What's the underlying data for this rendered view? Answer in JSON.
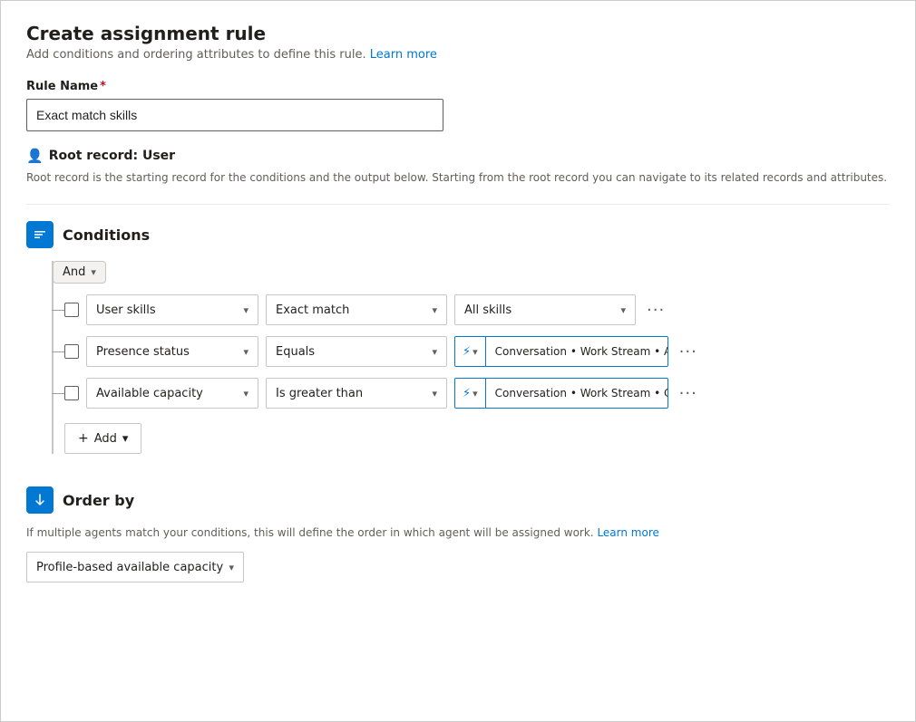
{
  "page": {
    "title": "Create assignment rule",
    "subtitle": "Add conditions and ordering attributes to define this rule.",
    "learn_more_link": "Learn more"
  },
  "rule_name": {
    "label": "Rule Name",
    "required": true,
    "value": "Exact match skills",
    "placeholder": "Rule Name"
  },
  "root_record": {
    "icon": "👤",
    "label": "Root record: User",
    "description": "Root record is the starting record for the conditions and the output below. Starting from the root record you can navigate to its related records and attributes."
  },
  "conditions": {
    "section_title": "Conditions",
    "and_label": "And",
    "rows": [
      {
        "field": "User skills",
        "operator": "Exact match",
        "value_text": "All skills",
        "value_type": "static",
        "has_dynamic": false
      },
      {
        "field": "Presence status",
        "operator": "Equals",
        "value_text": "Conversation • Work Stream • All...",
        "value_type": "dynamic",
        "has_dynamic": true
      },
      {
        "field": "Available capacity",
        "operator": "Is greater than",
        "value_text": "Conversation • Work Stream • Ca...",
        "value_type": "dynamic",
        "has_dynamic": true
      }
    ],
    "add_label": "Add"
  },
  "order_by": {
    "section_title": "Order by",
    "description": "If multiple agents match your conditions, this will define the order in which agent will be assigned work.",
    "learn_more_link": "Learn more",
    "value": "Profile-based available capacity"
  }
}
